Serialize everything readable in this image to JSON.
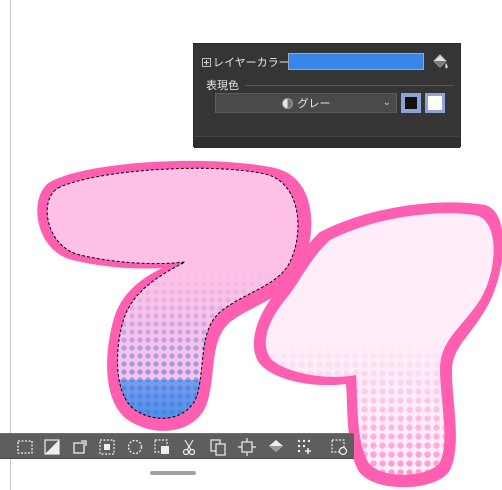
{
  "layer_panel": {
    "layer_color_label": "レイヤーカラー",
    "layer_color_value": "#3a86e8",
    "expression_color_label": "表現色",
    "expression_color_value": "グレー",
    "main_color": "#111111",
    "sub_color": "#ffffff"
  },
  "artwork": {
    "outline_color": "#ff5fb0",
    "fill_light": "#ffc0e8",
    "fill_pale": "#ffeefa",
    "halftone_blue": "#3a86e8",
    "halftone_pink": "#ff8fc9"
  },
  "toolbar": {
    "tools": [
      "deselect",
      "invert-selection",
      "crop",
      "show-selection",
      "expand-selection",
      "shrink-selection",
      "transform",
      "cut-paste",
      "copy-paste",
      "resize-canvas",
      "fill",
      "convert-to-halftone",
      "selection-settings"
    ]
  }
}
